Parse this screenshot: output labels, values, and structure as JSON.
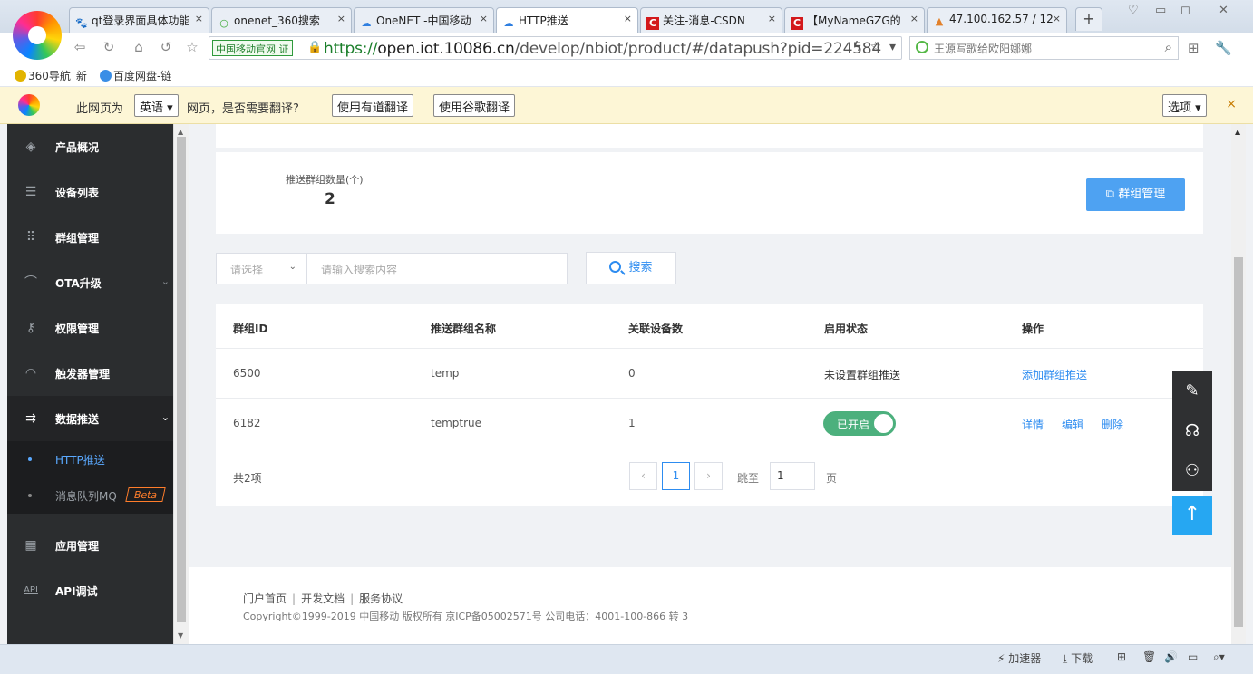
{
  "browser": {
    "tabs": [
      {
        "title": "qt登录界面具体功能",
        "icon": "🐾",
        "color": "#2f6fd0"
      },
      {
        "title": "onenet_360搜索",
        "icon": "○",
        "color": "#3aaa35"
      },
      {
        "title": "OneNET -中国移动",
        "icon": "☁",
        "color": "#2f7fe0"
      },
      {
        "title": "HTTP推送",
        "icon": "☁",
        "color": "#2f7fe0"
      },
      {
        "title": "关注-消息-CSDN",
        "icon": "C",
        "color": "#d3191c"
      },
      {
        "title": "【MyNameGZG的",
        "icon": "C",
        "color": "#d3191c"
      },
      {
        "title": "47.100.162.57 / 12",
        "icon": "▲",
        "color": "#e2802a"
      }
    ],
    "new_tab": "+",
    "address": {
      "badge": "中国移动官网 证",
      "scheme": "https://",
      "host": "open.iot.10086.cn",
      "path": "/develop/nbiot/product/#/datapush?pid=224584"
    },
    "search_text": "王源写歌给欧阳娜娜",
    "bookmarks": [
      "360导航_新",
      "百度网盘-链"
    ]
  },
  "translate_bar": {
    "prefix": "此网页为",
    "language": "英语",
    "suffix": "网页，是否需要翻译?",
    "youdao": "使用有道翻译",
    "google": "使用谷歌翻译",
    "options": "选项",
    "close": "×"
  },
  "sidebar": {
    "items": [
      {
        "label": "产品概况",
        "icon": "cube-icon"
      },
      {
        "label": "设备列表",
        "icon": "list-icon"
      },
      {
        "label": "群组管理",
        "icon": "grid-icon"
      },
      {
        "label": "OTA升级",
        "icon": "wifi-icon"
      },
      {
        "label": "权限管理",
        "icon": "key-icon"
      },
      {
        "label": "触发器管理",
        "icon": "gauge-icon"
      },
      {
        "label": "数据推送",
        "icon": "push-icon"
      },
      {
        "label": "应用管理",
        "icon": "apps-icon"
      },
      {
        "label": "API调试",
        "icon": "api-icon"
      }
    ],
    "sub_items": [
      {
        "label": "HTTP推送"
      },
      {
        "label": "消息队列MQ"
      }
    ],
    "beta": "Beta"
  },
  "main": {
    "stats": {
      "label": "推送群组数量(个)",
      "value": "2"
    },
    "group_manage_button": "群组管理",
    "filter": {
      "placeholder": "请选择"
    },
    "search": {
      "placeholder": "请输入搜索内容",
      "button": "搜索"
    },
    "table": {
      "headers": [
        "群组ID",
        "推送群组名称",
        "关联设备数",
        "启用状态",
        "操作"
      ],
      "rows": [
        {
          "id": "6500",
          "name": "temp",
          "count": "0",
          "status": "未设置群组推送",
          "action": "添加群组推送"
        },
        {
          "id": "6182",
          "name": "temptrue",
          "count": "1",
          "status": "已开启",
          "actions": [
            "详情",
            "编辑",
            "删除"
          ]
        }
      ]
    },
    "pagination": {
      "total": "共2项",
      "prev": "‹",
      "page": "1",
      "next": "›",
      "jump_label": "跳至",
      "jump_value": "1",
      "page_unit": "页"
    }
  },
  "footer": {
    "links": [
      "门户首页",
      "开发文档",
      "服务协议"
    ],
    "copyright": "Copyright©1999-2019 中国移动 版权所有 京ICP备05002571号 公司电话：4001-100-866 转 3"
  },
  "statusbar": {
    "accelerator": "加速器",
    "download": "下载"
  }
}
